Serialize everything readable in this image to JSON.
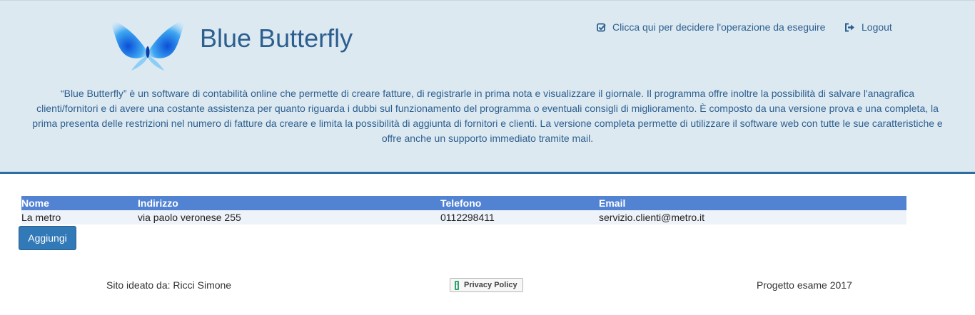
{
  "header": {
    "title": "Blue Butterfly",
    "nav": [
      {
        "label": "Clicca qui per decidere l'operazione da eseguire",
        "icon": "check-square-icon"
      },
      {
        "label": "Logout",
        "icon": "logout-icon"
      }
    ],
    "description": "“Blue Butterfly” è un software di contabilità online che permette di creare fatture, di registrarle in prima nota e visualizzare il giornale. Il programma offre inoltre la possibilità di salvare l'anagrafica clienti/fornitori e di avere una costante assistenza per quanto riguarda i dubbi sul funzionamento del programma o eventuali consigli di miglioramento. È composto da una versione prova e una completa, la prima presenta delle restrizioni nel numero di fatture da creare e limita la possibilità di aggiunta di fornitori e clienti. La versione completa permette di utilizzare il software web con tutte le sue caratteristiche e offre anche un supporto immediato tramite mail."
  },
  "table": {
    "columns": [
      "Nome",
      "Indirizzo",
      "Telefono",
      "Email"
    ],
    "rows": [
      [
        "La metro",
        "via paolo veronese 255",
        "0112298411",
        "servizio.clienti@metro.it"
      ]
    ]
  },
  "actions": {
    "add_label": "Aggiungi"
  },
  "footer": {
    "credit": "Sito ideato da: Ricci Simone",
    "privacy_label": "Privacy Policy",
    "project": "Progetto esame 2017"
  },
  "colors": {
    "header_bg": "#dde9f1",
    "accent": "#2e6da4",
    "table_header": "#5283d3",
    "button": "#3279b7"
  }
}
